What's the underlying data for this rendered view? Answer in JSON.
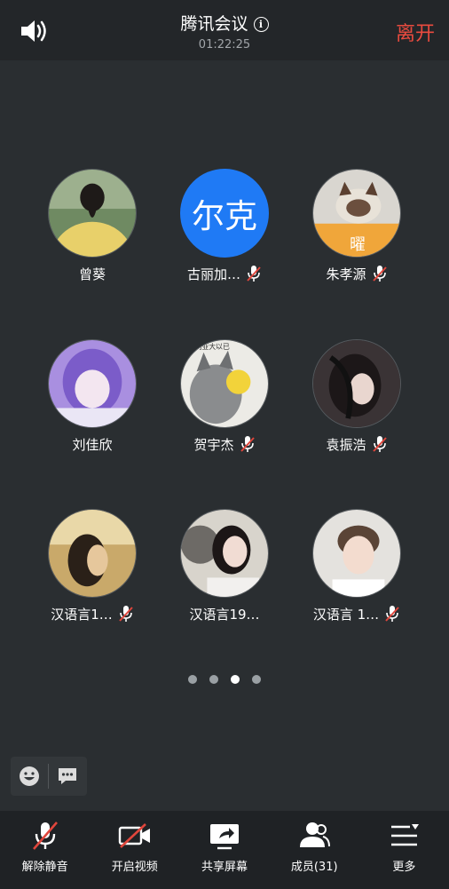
{
  "header": {
    "title": "腾讯会议",
    "timer": "01:22:25",
    "leave_label": "离开"
  },
  "participants": [
    {
      "name": "曾葵",
      "muted": false,
      "avatar": "photo-girl-back"
    },
    {
      "name": "古丽加…",
      "muted": true,
      "avatar_text": "尔克"
    },
    {
      "name": "朱孝源",
      "muted": true,
      "avatar": "photo-cat",
      "avatar_caption": "曜"
    },
    {
      "name": "刘佳欣",
      "muted": false,
      "avatar": "photo-anime"
    },
    {
      "name": "贺宇杰",
      "muted": true,
      "avatar": "photo-cartoon-wolf",
      "avatar_caption": "尼利亚大以已"
    },
    {
      "name": "袁振浩",
      "muted": true,
      "avatar": "photo-girl-hair"
    },
    {
      "name": "汉语言1…",
      "muted": true,
      "avatar": "photo-girl-profile"
    },
    {
      "name": "汉语言19…",
      "muted": false,
      "avatar": "photo-girl-fan"
    },
    {
      "name": "汉语言 1…",
      "muted": true,
      "avatar": "photo-boy-smile"
    }
  ],
  "pagination": {
    "pages": 4,
    "current": 3
  },
  "toolbar": {
    "unmute_label": "解除静音",
    "video_label": "开启视频",
    "share_label": "共享屏幕",
    "members_label": "成员(31)",
    "more_label": "更多"
  },
  "colors": {
    "background": "#2a2e31",
    "leave": "#ea4b3f",
    "text_avatar": "#1f7af5",
    "mute_slash": "#e0463c"
  }
}
